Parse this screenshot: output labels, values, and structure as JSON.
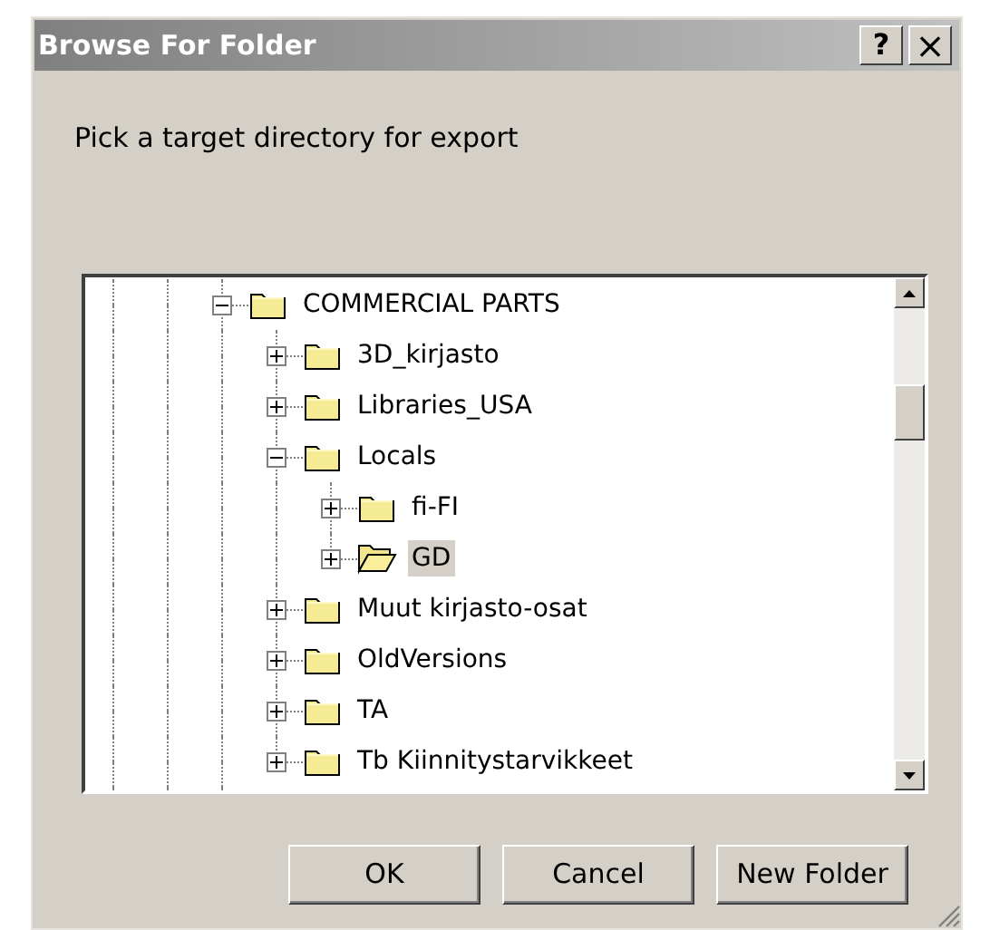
{
  "window": {
    "title": "Browse For Folder",
    "help_button": "?",
    "close_button": "×"
  },
  "prompt": "Pick a target directory for export",
  "tree": [
    {
      "label": "COMMERCIAL PARTS",
      "expanded": true,
      "selected": false,
      "children": [
        {
          "label": "3D_kirjasto",
          "expanded": false,
          "selected": false
        },
        {
          "label": "Libraries_USA",
          "expanded": false,
          "selected": false
        },
        {
          "label": "Locals",
          "expanded": true,
          "selected": false,
          "children": [
            {
              "label": "fi-FI",
              "expanded": false,
              "selected": false
            },
            {
              "label": "GD",
              "expanded": false,
              "selected": true
            }
          ]
        },
        {
          "label": "Muut kirjasto-osat",
          "expanded": false,
          "selected": false
        },
        {
          "label": "OldVersions",
          "expanded": false,
          "selected": false
        },
        {
          "label": "TA",
          "expanded": false,
          "selected": false
        },
        {
          "label": "Tb Kiinnitystarvikkeet",
          "expanded": false,
          "selected": false
        }
      ]
    }
  ],
  "buttons": [
    "OK",
    "Cancel",
    "New Folder"
  ]
}
